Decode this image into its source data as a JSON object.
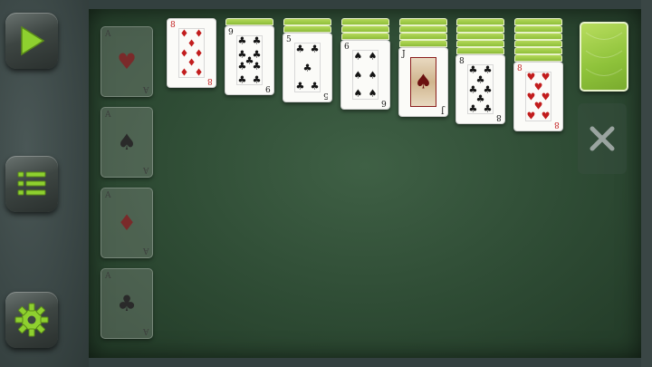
{
  "sidebar": {
    "buttons": [
      {
        "name": "play",
        "icon": "play-icon"
      },
      {
        "name": "menu",
        "icon": "list-icon"
      },
      {
        "name": "settings",
        "icon": "gear-icon"
      }
    ]
  },
  "colors": {
    "accent_green": "#8ec23a",
    "felt": "#2e4b34",
    "red_suit": "#c21d1d"
  },
  "foundations": [
    {
      "suit": "♥",
      "suit_color": "red"
    },
    {
      "suit": "♠",
      "suit_color": "black"
    },
    {
      "suit": "♦",
      "suit_color": "red"
    },
    {
      "suit": "♣",
      "suit_color": "black"
    }
  ],
  "tableau": [
    {
      "hidden": 0,
      "rank": "8",
      "suit": "♦",
      "color": "red"
    },
    {
      "hidden": 1,
      "rank": "9",
      "suit": "♣",
      "color": "black"
    },
    {
      "hidden": 2,
      "rank": "5",
      "suit": "♣",
      "color": "black"
    },
    {
      "hidden": 3,
      "rank": "6",
      "suit": "♠",
      "color": "black"
    },
    {
      "hidden": 4,
      "rank": "J",
      "suit": "♠",
      "color": "black",
      "face": true
    },
    {
      "hidden": 5,
      "rank": "8",
      "suit": "♣",
      "color": "black"
    },
    {
      "hidden": 6,
      "rank": "8",
      "suit": "♥",
      "color": "red"
    }
  ],
  "stock": {
    "icon": "card-back"
  },
  "waste": {
    "icon": "close-icon"
  }
}
